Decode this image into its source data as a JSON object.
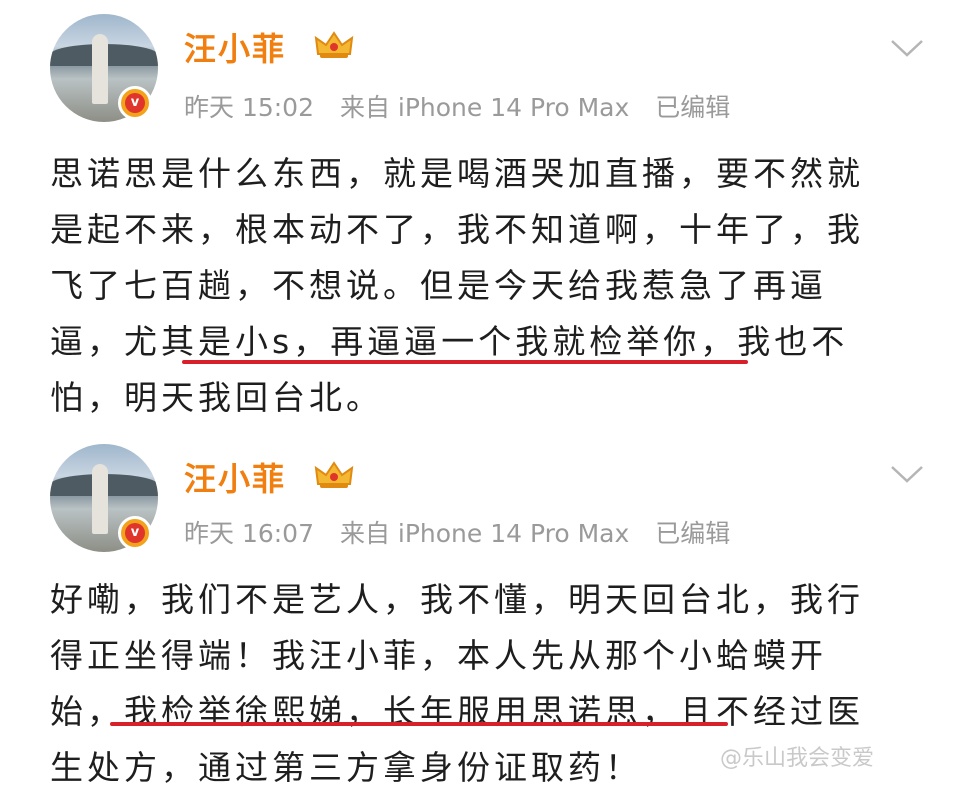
{
  "posts": [
    {
      "username": "汪小菲",
      "time": "昨天 15:02",
      "source": "来自 iPhone 14 Pro Max",
      "edited": "已编辑",
      "lines": [
        "思诺思是什么东西，就是喝酒哭加直播，要不然就",
        "是起不来，根本动不了，我不知道啊，十年了，我",
        "飞了七百趟，不想说。但是今天给我惹急了再逼",
        "逼，尤其是小s，再逼逼一个我就检举你，我也不",
        "怕，明天我回台北。"
      ]
    },
    {
      "username": "汪小菲",
      "time": "昨天 16:07",
      "source": "来自 iPhone 14 Pro Max",
      "edited": "已编辑",
      "lines": [
        "好嘞，我们不是艺人，我不懂，明天回台北，我行",
        "得正坐得端！我汪小菲，本人先从那个小蛤蟆开",
        "始，我检举徐熙娣，长年服用思诺思，且不经过医",
        "生处方，通过第三方拿身份证取药！"
      ]
    }
  ],
  "watermark": "@乐山我会变爱",
  "icons": {
    "verified": "verified-v-badge-icon",
    "crown": "vip-crown-icon",
    "expand": "chevron-down-icon"
  },
  "colors": {
    "username": "#f07f10",
    "meta": "#9a9a9a",
    "underline": "#d8202a",
    "text": "#1e1e1e"
  }
}
